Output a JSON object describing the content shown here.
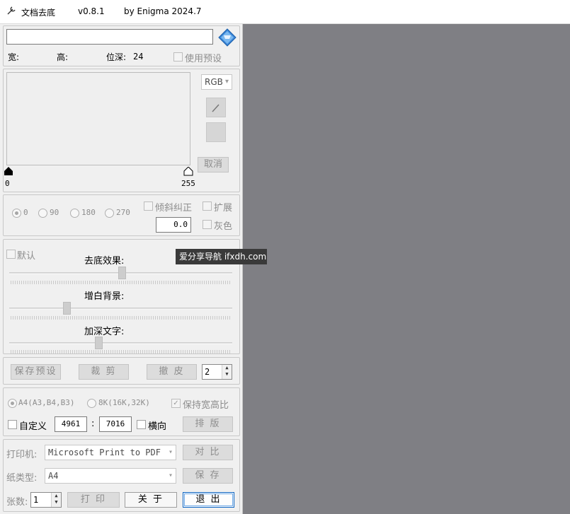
{
  "app": {
    "title": "文档去底",
    "version": "v0.8.1",
    "author": "by Enigma 2024.7"
  },
  "file": {
    "path_value": "",
    "width_label": "宽:",
    "height_label": "高:",
    "depth_label": "位深:",
    "depth_value": "24",
    "use_preset_label": "使用预设"
  },
  "histogram": {
    "mode_options": [
      "RGB"
    ],
    "mode_value": "RGB",
    "min_value": "0",
    "max_value": "255",
    "cancel_label": "取消"
  },
  "rotation": {
    "options": [
      "0",
      "90",
      "180",
      "270"
    ],
    "selected": "0",
    "deskew_label": "倾斜纠正",
    "expand_label": "扩展",
    "gray_label": "灰色",
    "angle_value": "0.0"
  },
  "effects": {
    "default_label": "默认",
    "remove_bg_label": "去底效果:",
    "whiten_bg_label": "增白背景:",
    "darken_text_label": "加深文字:",
    "remove_bg_level": 0.5,
    "whiten_bg_level": 0.27,
    "darken_text_level": 0.4
  },
  "actions": {
    "save_preset_label": "保存预设",
    "crop_label": "裁 剪",
    "restore_label": "撤 皮",
    "count_value": "2"
  },
  "paper_size": {
    "a4_label": "A4(A3,B4,B3)",
    "k8_label": "8K(16K,32K)",
    "keep_ratio_label": "保持宽高比",
    "custom_label": "自定义",
    "width_value": "4961",
    "height_value": "7016",
    "separator": ":",
    "landscape_label": "横向",
    "layout_label": "排 版"
  },
  "print": {
    "printer_label": "打印机:",
    "printer_value": "Microsoft Print to PDF",
    "compare_label": "对 比",
    "paper_type_label": "纸类型:",
    "paper_type_value": "A4",
    "save_label": "保 存",
    "copies_label": "张数:",
    "copies_value": "1",
    "print_label": "打 印",
    "about_label": "关 于",
    "exit_label": "退 出"
  },
  "watermark": {
    "text": "爱分享导航 ifxdh.com"
  },
  "colors": {
    "canvas_bg": "#7f7f84",
    "panel_bg": "#f0f0f0",
    "accent": "#0a63c2",
    "disabled_text": "#8d8d8d"
  }
}
